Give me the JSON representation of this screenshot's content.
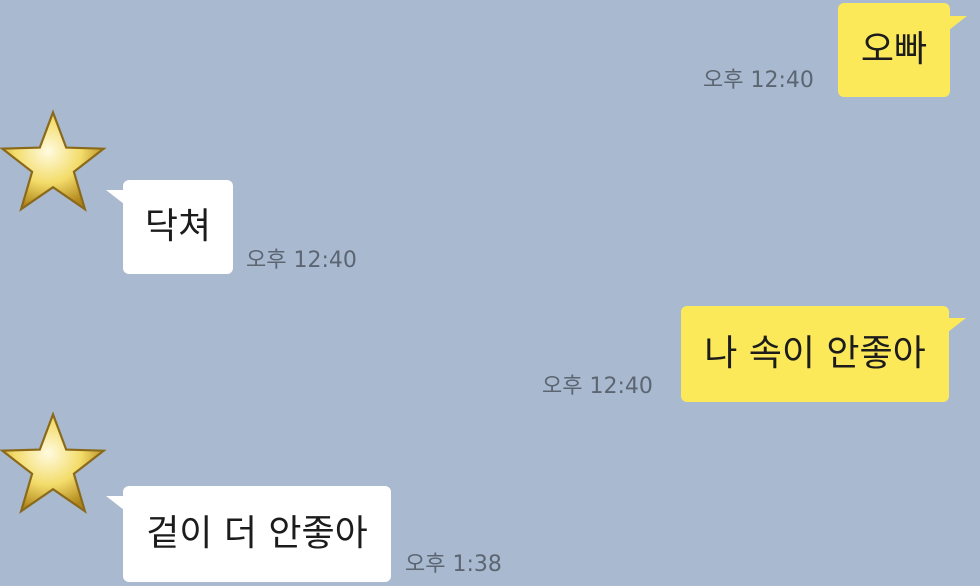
{
  "theme": {
    "background": "#a9b9cf",
    "sent_bubble": "#fbe95a",
    "received_bubble": "#ffffff",
    "timestamp_color": "#5c6673"
  },
  "messages": [
    {
      "direction": "sent",
      "text": "오빠",
      "time": "오후 12:40"
    },
    {
      "direction": "received",
      "text": "닥쳐",
      "time": "오후 12:40",
      "avatar": "star-icon"
    },
    {
      "direction": "sent",
      "text": "나 속이 안좋아",
      "time": "오후 12:40"
    },
    {
      "direction": "received",
      "text": "겉이 더 안좋아",
      "time": "오후 1:38",
      "avatar": "star-icon"
    }
  ]
}
